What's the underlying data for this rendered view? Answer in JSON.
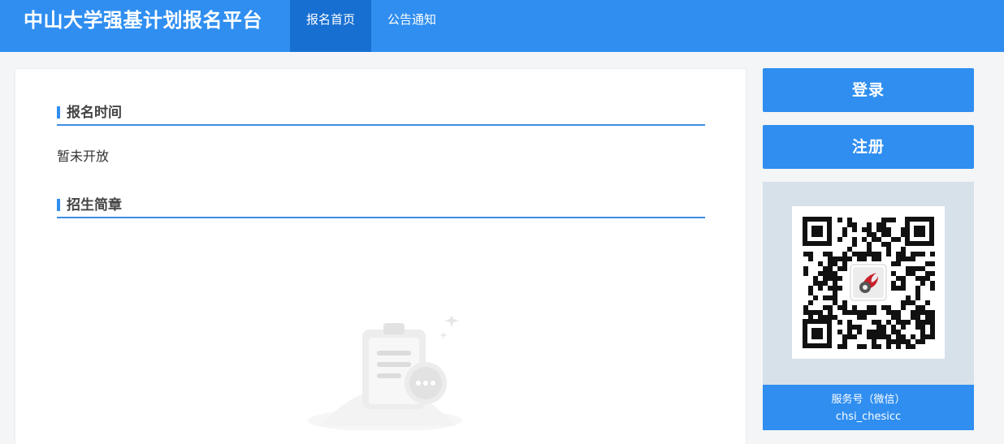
{
  "header": {
    "site_title": "中山大学强基计划报名平台",
    "nav": [
      {
        "label": "报名首页",
        "active": true
      },
      {
        "label": "公告通知",
        "active": false
      }
    ]
  },
  "main": {
    "sections": [
      {
        "title": "报名时间"
      },
      {
        "title": "招生简章"
      }
    ],
    "registration_status": "暂未开放"
  },
  "sidebar": {
    "login_label": "登录",
    "register_label": "注册",
    "qr": {
      "caption_line1": "服务号（微信）",
      "caption_line2": "chsi_chesicc"
    }
  },
  "colors": {
    "brand_blue": "#2f8ef0",
    "nav_active": "#176fd1",
    "page_bg": "#f4f5f7",
    "qr_panel_bg": "#d7e1ea"
  },
  "icons": [
    "empty-clipboard-icon",
    "qr-code-icon",
    "chsi-logo-icon"
  ]
}
